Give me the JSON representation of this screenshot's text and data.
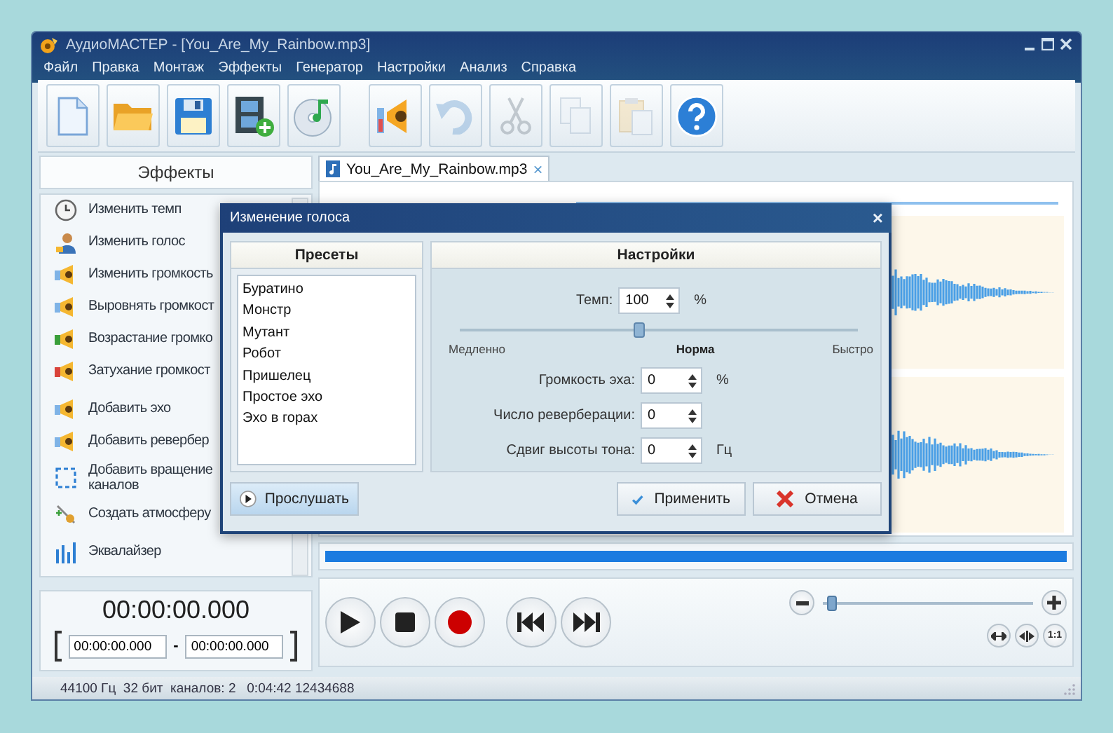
{
  "window": {
    "title": "АудиоМАСТЕР - [You_Are_My_Rainbow.mp3]"
  },
  "menu": [
    "Файл",
    "Правка",
    "Монтаж",
    "Эффекты",
    "Генератор",
    "Настройки",
    "Анализ",
    "Справка"
  ],
  "toolbar": [
    {
      "disabled": false
    },
    {
      "disabled": false
    },
    {
      "disabled": false
    },
    {
      "disabled": false
    },
    {
      "disabled": false
    },
    {
      "disabled": false
    },
    {
      "disabled": true
    },
    {
      "disabled": true
    },
    {
      "disabled": true
    },
    {
      "disabled": true
    },
    {
      "disabled": false
    }
  ],
  "effects_panel": {
    "title": "Эффекты",
    "groups": [
      [
        "Изменить темп",
        "Изменить голос",
        "Изменить громкость",
        "Выровнять громкост",
        "Возрастание громко",
        "Затухание громкост"
      ],
      [
        "Добавить эхо",
        "Добавить ревербер",
        "Добавить вращение\nканалов",
        "Создать атмосферу"
      ],
      [
        "Эквалайзер"
      ]
    ]
  },
  "tab": {
    "label": "You_Are_My_Rainbow.mp3",
    "close": "×"
  },
  "dialog": {
    "title": "Изменение голоса",
    "close": "×",
    "presets": {
      "title": "Пресеты",
      "items": [
        {
          "label": "Буратино",
          "selected": false
        },
        {
          "label": "Монстр",
          "selected": false
        },
        {
          "label": "Мутант",
          "selected": false
        },
        {
          "label": "Робот",
          "selected": false
        },
        {
          "label": "Пришелец",
          "selected": false
        },
        {
          "label": "Простое эхо",
          "selected": false
        },
        {
          "label": "Эхо в горах",
          "selected": false
        }
      ]
    },
    "settings": {
      "title": "Настройки",
      "tempo": {
        "label": "Темп:",
        "value": "100",
        "unit": "%"
      },
      "slider": {
        "level": 0.45,
        "min_label": "Медленно",
        "mid_label": "Норма",
        "max_label": "Быстро"
      },
      "fields": [
        {
          "label": "Громкость эха:",
          "value": "0",
          "unit": "%"
        },
        {
          "label": "Число реверберации:",
          "value": "0"
        },
        {
          "label": "Сдвиг высоты тона:",
          "value": "0",
          "unit": "Гц"
        }
      ]
    },
    "listen_button": "Прослушать",
    "apply_button": "Применить",
    "cancel_button": "Отмена"
  },
  "time": {
    "current": "00:00:00.000",
    "start": "00:00:00.000",
    "separator": "-",
    "end": "00:00:00.000"
  },
  "zoom": {
    "level": 0.02,
    "one_to_one": "1:1"
  },
  "status_bar": "44100 Гц  32 бит  каналов: 2   0:04:42 12434688"
}
